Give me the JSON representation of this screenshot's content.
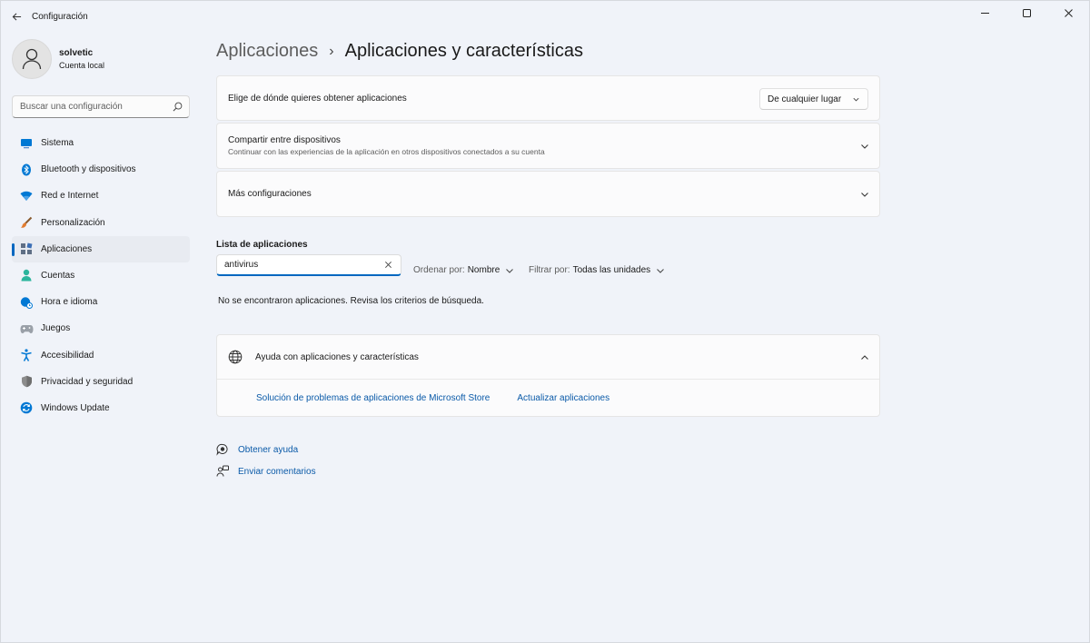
{
  "window": {
    "title": "Configuración"
  },
  "profile": {
    "name": "solvetic",
    "account_type": "Cuenta local"
  },
  "search": {
    "placeholder": "Buscar una configuración"
  },
  "sidebar": {
    "items": [
      {
        "label": "Sistema",
        "icon": "system-icon",
        "color": "#0078d4"
      },
      {
        "label": "Bluetooth y dispositivos",
        "icon": "bluetooth-icon",
        "color": "#0078d4"
      },
      {
        "label": "Red e Internet",
        "icon": "wifi-icon",
        "color": "#0078d4"
      },
      {
        "label": "Personalización",
        "icon": "brush-icon",
        "color": "#e27d32"
      },
      {
        "label": "Aplicaciones",
        "icon": "apps-icon",
        "color": "#5f6f85",
        "active": true
      },
      {
        "label": "Cuentas",
        "icon": "person-icon",
        "color": "#2cb59d"
      },
      {
        "label": "Hora e idioma",
        "icon": "globe-clock-icon",
        "color": "#0078d4"
      },
      {
        "label": "Juegos",
        "icon": "gamepad-icon",
        "color": "#8a8a8a"
      },
      {
        "label": "Accesibilidad",
        "icon": "accessibility-icon",
        "color": "#0078d4"
      },
      {
        "label": "Privacidad y seguridad",
        "icon": "shield-icon",
        "color": "#7a7a7a"
      },
      {
        "label": "Windows Update",
        "icon": "update-icon",
        "color": "#0078d4"
      }
    ]
  },
  "breadcrumb": {
    "parent": "Aplicaciones",
    "separator": "›",
    "current": "Aplicaciones y características"
  },
  "settings": {
    "source": {
      "label": "Elige de dónde quieres obtener aplicaciones",
      "value": "De cualquier lugar"
    },
    "share": {
      "title": "Compartir entre dispositivos",
      "subtitle": "Continuar con las experiencias de la aplicación en otros dispositivos conectados a su cuenta"
    },
    "more": {
      "title": "Más configuraciones"
    }
  },
  "app_list": {
    "title": "Lista de aplicaciones",
    "search_value": "antivirus",
    "sort_label": "Ordenar por:",
    "sort_value": "Nombre",
    "filter_label": "Filtrar por:",
    "filter_value": "Todas las unidades",
    "empty_message": "No se encontraron aplicaciones. Revisa los criterios de búsqueda."
  },
  "help": {
    "title": "Ayuda con aplicaciones y características",
    "links": [
      "Solución de problemas de aplicaciones de Microsoft Store",
      "Actualizar aplicaciones"
    ]
  },
  "footer": {
    "get_help": "Obtener ayuda",
    "feedback": "Enviar comentarios"
  },
  "colors": {
    "accent": "#0067c0",
    "link": "#0a5aa8"
  }
}
